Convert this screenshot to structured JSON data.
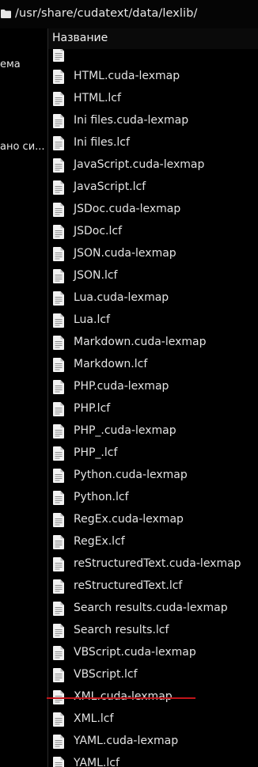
{
  "path_bar": {
    "path": "/usr/share/cudatext/data/lexlib/",
    "icon": "folder-icon"
  },
  "sidebar": {
    "items": [
      {
        "label": "ема"
      },
      {
        "label": "ано си..."
      }
    ]
  },
  "file_list": {
    "column_header": "Название",
    "file_icon": "text-file-icon",
    "files": [
      "",
      "HTML.cuda-lexmap",
      "HTML.lcf",
      "Ini files.cuda-lexmap",
      "Ini files.lcf",
      "JavaScript.cuda-lexmap",
      "JavaScript.lcf",
      "JSDoc.cuda-lexmap",
      "JSDoc.lcf",
      "JSON.cuda-lexmap",
      "JSON.lcf",
      "Lua.cuda-lexmap",
      "Lua.lcf",
      "Markdown.cuda-lexmap",
      "Markdown.lcf",
      "PHP.cuda-lexmap",
      "PHP.lcf",
      "PHP_.cuda-lexmap",
      "PHP_.lcf",
      "Python.cuda-lexmap",
      "Python.lcf",
      "RegEx.cuda-lexmap",
      "RegEx.lcf",
      "reStructuredText.cuda-lexmap",
      "reStructuredText.lcf",
      "Search results.cuda-lexmap",
      "Search results.lcf",
      "VBScript.cuda-lexmap",
      "VBScript.lcf",
      "XML.cuda-lexmap",
      "XML.lcf",
      "YAML.cuda-lexmap",
      "YAML.lcf"
    ]
  },
  "colors": {
    "background": "#000000",
    "text": "#e3e3e3",
    "annotation_underline": "#c0151a"
  }
}
